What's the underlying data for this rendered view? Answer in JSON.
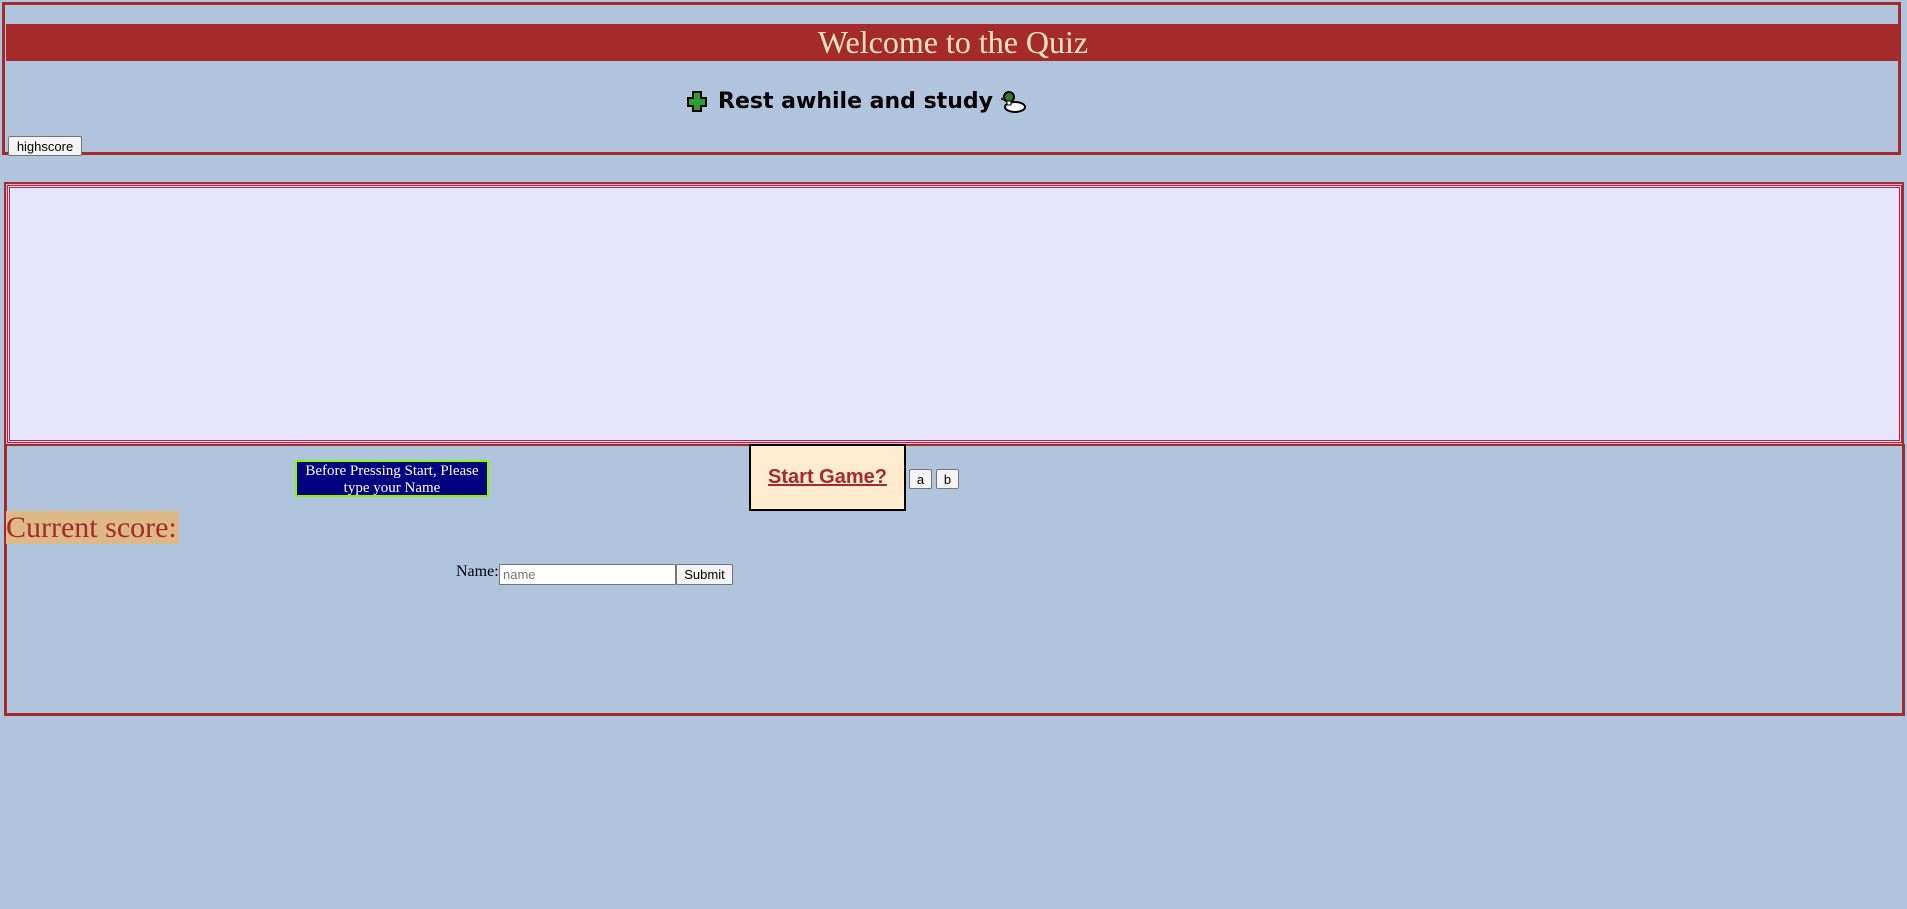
{
  "header": {
    "title": "Welcome to the Quiz",
    "subtitle": "Rest awhile and study",
    "highscore_label": "highscore"
  },
  "controls": {
    "notice": "Before Pressing Start, Please type your Name",
    "start_label": "Start Game?",
    "btn_a": "a",
    "btn_b": "b"
  },
  "score": {
    "label": "Current score:"
  },
  "form": {
    "name_label": "Name:",
    "name_placeholder": "name",
    "submit_label": "Submit"
  },
  "colors": {
    "page_bg": "#b0c4de",
    "brand": "#a52a2a",
    "quiz_bg": "#e6e6fa",
    "notice_bg": "#000080",
    "start_bg": "#ffebcd",
    "score_bg": "#deb887"
  },
  "icons": [
    "puzzle-piece-icon",
    "duck-icon"
  ]
}
